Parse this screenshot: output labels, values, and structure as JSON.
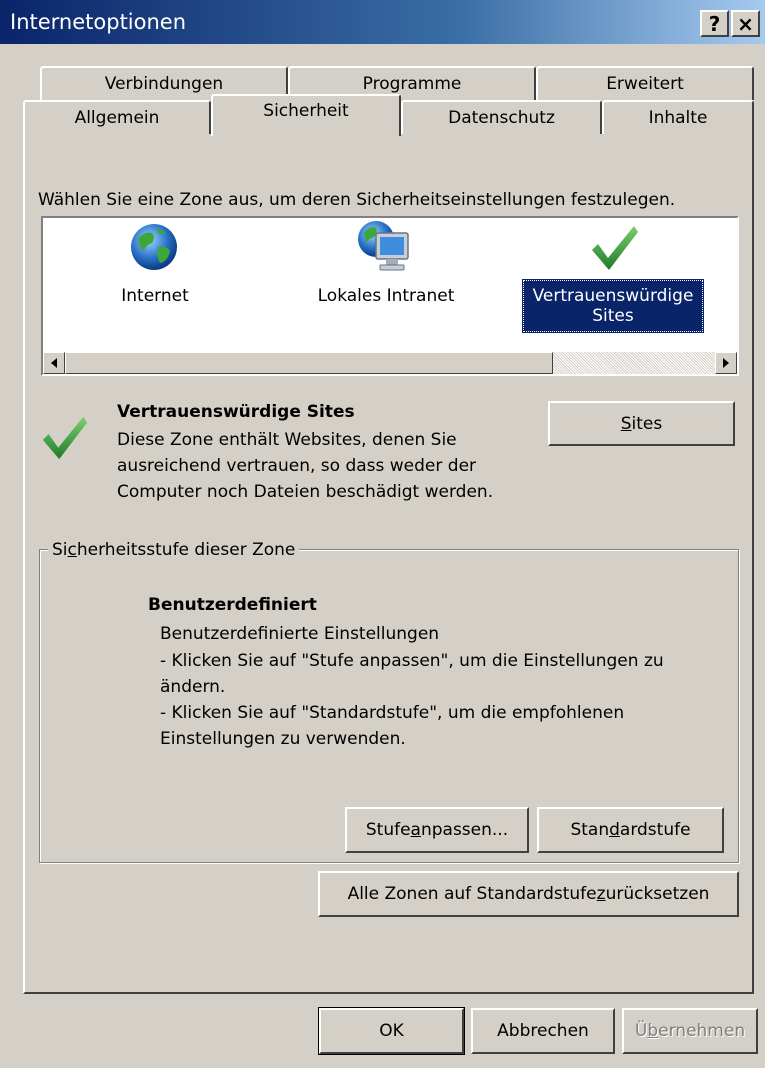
{
  "window": {
    "title": "Internetoptionen",
    "help_button": "?",
    "close_button": "×"
  },
  "tabs": {
    "row1": [
      {
        "label": "Verbindungen"
      },
      {
        "label": "Programme"
      },
      {
        "label": "Erweitert"
      }
    ],
    "row2": [
      {
        "label": "Allgemein"
      },
      {
        "label": "Sicherheit",
        "active": true
      },
      {
        "label": "Datenschutz"
      },
      {
        "label": "Inhalte"
      }
    ]
  },
  "security": {
    "instruction": "Wählen Sie eine Zone aus, um deren Sicherheitseinstellungen festzulegen.",
    "zones": [
      {
        "label": "Internet",
        "icon": "globe-icon"
      },
      {
        "label": "Lokales Intranet",
        "icon": "intranet-icon"
      },
      {
        "label_line1": "Vertrauenswürdige",
        "label_line2": "Sites",
        "icon": "checkmark-icon",
        "selected": true
      }
    ],
    "zone_info": {
      "title": "Vertrauenswürdige Sites",
      "line1": "Diese Zone enthält Websites, denen Sie",
      "line2": "ausreichend vertrauen, so dass weder der",
      "line3": "Computer noch Dateien beschädigt werden."
    },
    "sites_button": {
      "pre": "",
      "u": "S",
      "post": "ites"
    },
    "level_group": {
      "label_pre": "Si",
      "label_u": "c",
      "label_post": "herheitsstufe dieser Zone",
      "level_name": "Benutzerdefiniert",
      "desc1": "Benutzerdefinierte Einstellungen",
      "desc2": "- Klicken Sie auf \"Stufe anpassen\", um die Einstellungen zu",
      "desc3": "ändern.",
      "desc4": "- Klicken Sie auf \"Standardstufe\", um die empfohlenen",
      "desc5": "Einstellungen zu verwenden.",
      "custom_button": {
        "pre": "Stufe ",
        "u": "a",
        "post": "npassen..."
      },
      "default_button": {
        "pre": "Stan",
        "u": "d",
        "post": "ardstufe"
      }
    },
    "reset_all_button": {
      "pre": "Alle Zonen auf Standardstufe ",
      "u": "z",
      "post": "urücksetzen"
    }
  },
  "footer": {
    "ok": "OK",
    "cancel": "Abbrechen",
    "apply_pre": "Ü",
    "apply_u": "b",
    "apply_post": "ernehmen"
  },
  "colors": {
    "titlebar": "#0a246a",
    "selection": "#0a246a",
    "face": "#d4d0c8",
    "check_green": "#3a9a3a"
  }
}
